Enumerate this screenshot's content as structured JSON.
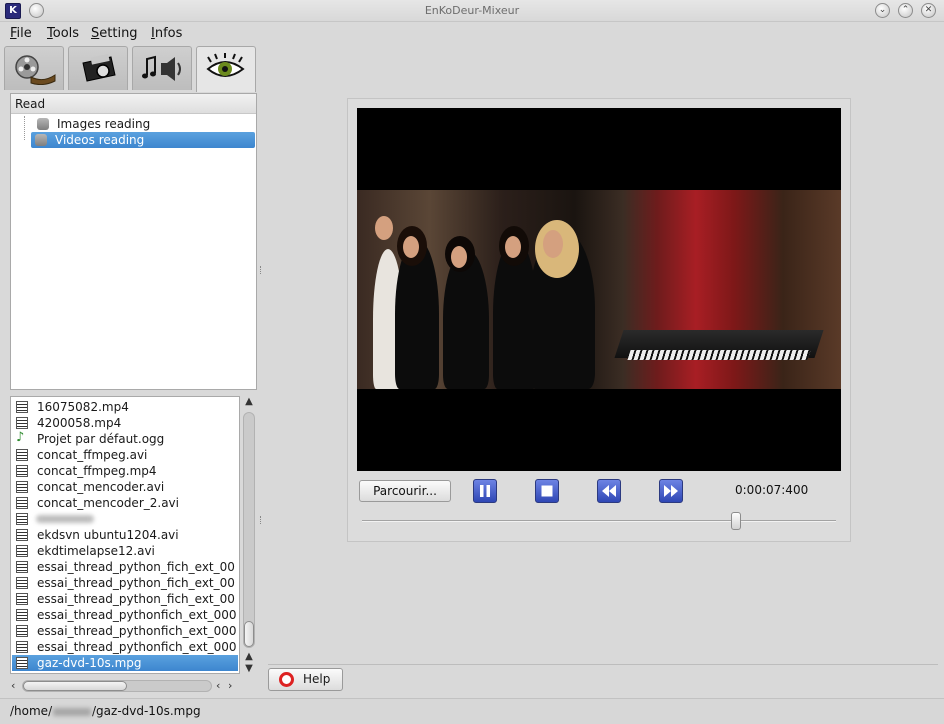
{
  "window": {
    "title": "EnKoDeur-Mixeur",
    "app_icon_glyph": "K"
  },
  "menubar": {
    "items": [
      "File",
      "Tools",
      "Setting",
      "Infos"
    ]
  },
  "tabs": [
    {
      "icon": "film-reel-icon"
    },
    {
      "icon": "camera-icon"
    },
    {
      "icon": "music-speaker-icon"
    },
    {
      "icon": "eye-icon",
      "active": true
    }
  ],
  "tree": {
    "header": "Read",
    "items": [
      {
        "label": "Images reading",
        "selected": false
      },
      {
        "label": "Videos reading",
        "selected": true
      }
    ]
  },
  "files": [
    {
      "name": "16075082.mp4",
      "type": "video"
    },
    {
      "name": "4200058.mp4",
      "type": "video"
    },
    {
      "name": "Projet par défaut.ogg",
      "type": "audio"
    },
    {
      "name": "concat_ffmpeg.avi",
      "type": "video"
    },
    {
      "name": "concat_ffmpeg.mp4",
      "type": "video"
    },
    {
      "name": "concat_mencoder.avi",
      "type": "video"
    },
    {
      "name": "concat_mencoder_2.avi",
      "type": "video"
    },
    {
      "name": "",
      "type": "video",
      "blurred": true
    },
    {
      "name": "ekdsvn ubuntu1204.avi",
      "type": "video"
    },
    {
      "name": "ekdtimelapse12.avi",
      "type": "video"
    },
    {
      "name": "essai_thread_python_fich_ext_00",
      "type": "video"
    },
    {
      "name": "essai_thread_python_fich_ext_00",
      "type": "video"
    },
    {
      "name": "essai_thread_python_fich_ext_00",
      "type": "video"
    },
    {
      "name": "essai_thread_pythonfich_ext_000",
      "type": "video"
    },
    {
      "name": "essai_thread_pythonfich_ext_000",
      "type": "video"
    },
    {
      "name": "essai_thread_pythonfich_ext_000",
      "type": "video"
    },
    {
      "name": "gaz-dvd-10s.mpg",
      "type": "video",
      "selected": true
    }
  ],
  "player": {
    "browse_label": "Parcourir...",
    "time": "0:00:07:400",
    "buttons": [
      "pause-icon",
      "stop-icon",
      "rewind-icon",
      "fast-forward-icon"
    ],
    "progress": 0.79
  },
  "help_label": "Help",
  "status": {
    "path_prefix": "/home/",
    "path_suffix": "/gaz-dvd-10s.mpg"
  }
}
